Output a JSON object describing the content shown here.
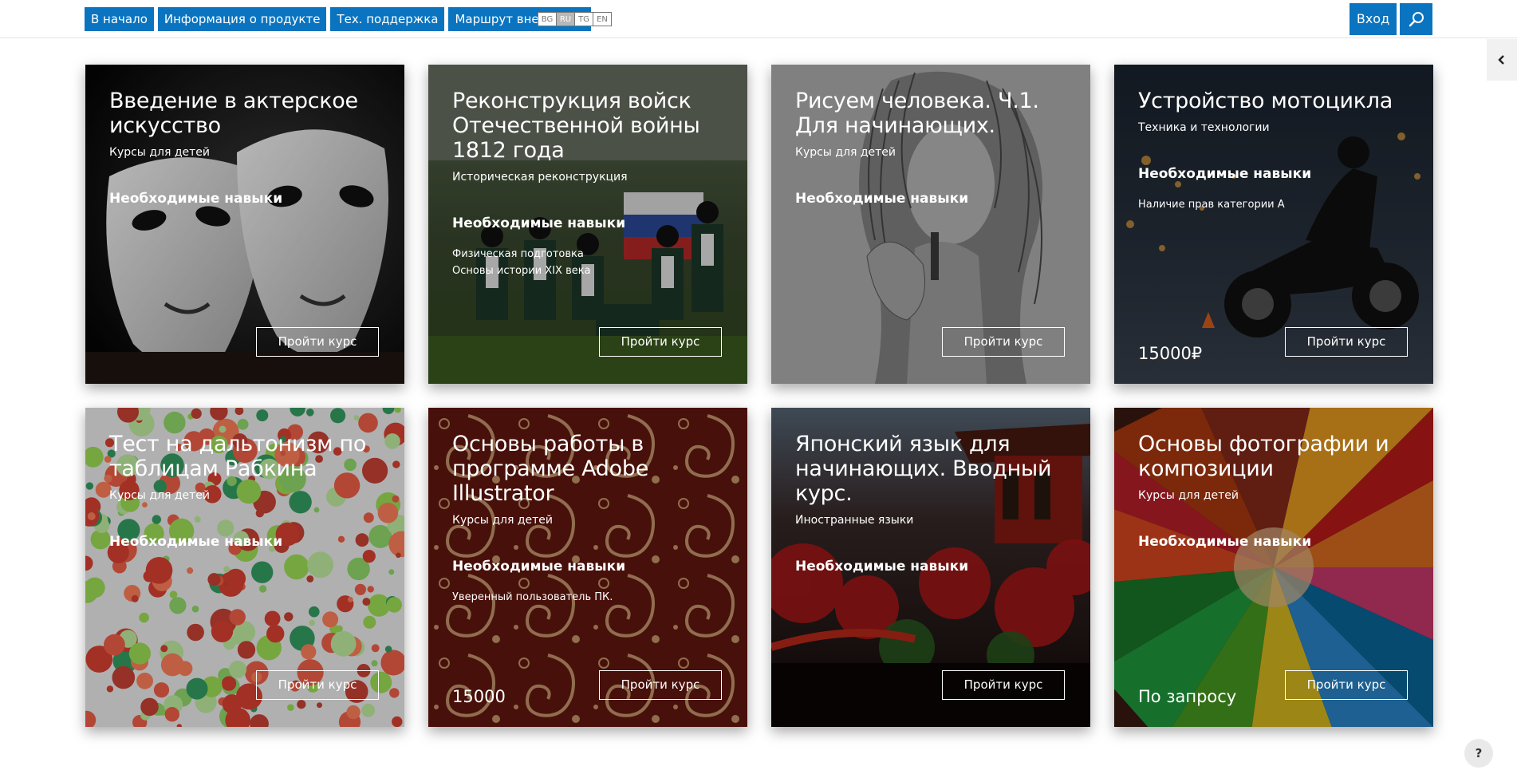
{
  "nav": {
    "items": [
      {
        "label": "В начало"
      },
      {
        "label": "Информация о продукте"
      },
      {
        "label": "Тех. поддержка"
      },
      {
        "label": "Маршрут внедрения"
      }
    ],
    "languages": [
      "BG",
      "RU",
      "TG",
      "EN"
    ],
    "active_language": "RU",
    "login_label": "Вход"
  },
  "icons": {
    "search": "search-icon",
    "side_toggle": "chevron-left-icon",
    "help": "?"
  },
  "colors": {
    "accent": "#0a74c0"
  },
  "courses": [
    {
      "title": "Введение в актерское искусство",
      "category": "Курсы для детей",
      "skills_heading": "Необходимые навыки",
      "skills": [],
      "price": "",
      "button": "Пройти курс",
      "image": "theatre-masks"
    },
    {
      "title": "Реконструкция войск Отечественной войны 1812 года",
      "category": "Историческая реконструкция",
      "skills_heading": "Необходимые навыки",
      "skills": [
        "Физическая подготовка",
        "Основы истории XIX века"
      ],
      "price": "",
      "button": "Пройти курс",
      "image": "reenactment-soldiers"
    },
    {
      "title": "Рисуем человека. Ч.1. Для начинающих.",
      "category": "Курсы для детей",
      "skills_heading": "Необходимые навыки",
      "skills": [],
      "price": "",
      "button": "Пройти курс",
      "image": "pencil-portrait"
    },
    {
      "title": "Устройство мотоцикла",
      "category": "Техника и технологии",
      "skills_heading": "Необходимые навыки",
      "skills": [
        "Наличие прав категории А"
      ],
      "price": "15000₽",
      "button": "Пройти курс",
      "image": "motorcycle-night"
    },
    {
      "title": "Тест на дальтонизм по таблицам Рабкина",
      "category": "Курсы для детей",
      "skills_heading": "Необходимые навыки",
      "skills": [],
      "price": "",
      "button": "Пройти курс",
      "image": "color-dots"
    },
    {
      "title": "Основы работы в программе Adobe Illustrator",
      "category": "Курсы для детей",
      "skills_heading": "Необходимые навыки",
      "skills": [
        "Уверенный пользователь ПК."
      ],
      "price": "15000",
      "button": "Пройти курс",
      "image": "paisley-pattern"
    },
    {
      "title": "Японский язык для начинающих. Вводный курс.",
      "category": "Иностранные языки",
      "skills_heading": "Необходимые навыки",
      "skills": [],
      "price": "",
      "button": "Пройти курс",
      "image": "japanese-garden"
    },
    {
      "title": "Основы фотографии и композиции",
      "category": "Курсы для детей",
      "skills_heading": "Необходимые навыки",
      "skills": [],
      "price": "По запросу",
      "button": "Пройти курс",
      "image": "colored-pencils"
    }
  ]
}
